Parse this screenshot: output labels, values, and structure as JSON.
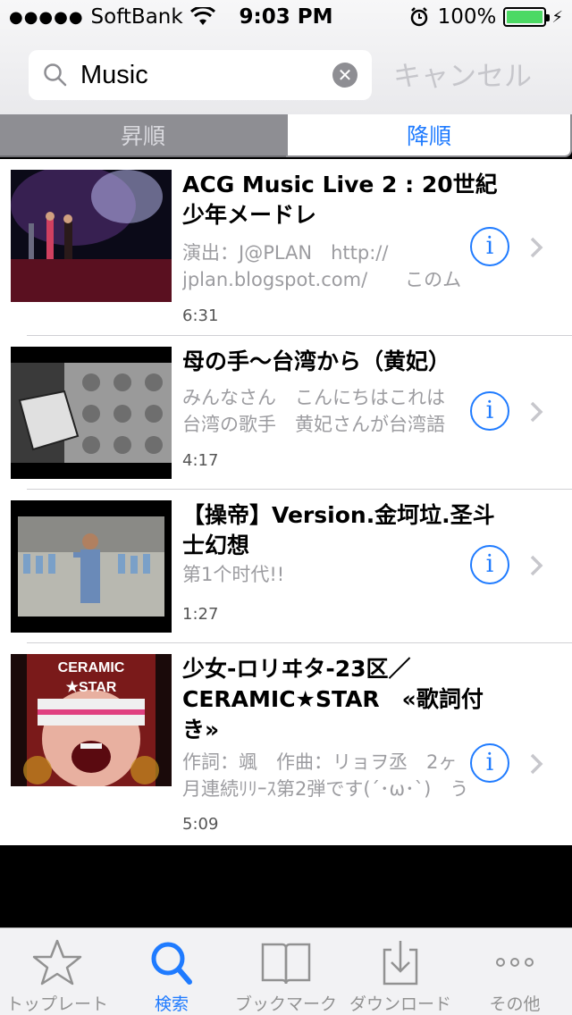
{
  "status": {
    "carrier": "SoftBank",
    "time": "9:03 PM",
    "battery": "100%"
  },
  "search": {
    "value": "Music",
    "cancel_label": "キャンセル"
  },
  "sort": {
    "ascending": "昇順",
    "descending": "降順"
  },
  "items": [
    {
      "title": "ACG Music Live 2 : 20世紀少年メードレ",
      "description": "演出：J@PLAN　http://\njplan.blogspot.com/　　このム",
      "duration": "6:31"
    },
    {
      "title": "母の手〜台湾から（黄妃）",
      "description": "みんなさん　こんにちはこれは\n台湾の歌手　黄妃さんが台湾語",
      "duration": "4:17"
    },
    {
      "title": "【操帝】Version.金坷垃.圣斗士幻想",
      "description": "第1个时代!!",
      "duration": "1:27"
    },
    {
      "title": "少女-ロリヰタ-23区／CERAMIC★STAR　«歌詞付き»",
      "description": "作詞：颯　作曲：リョヲ丞　2ヶ\n月連続ﾘﾘｰｽ第2弾です(´･ω･`)　う",
      "duration": "5:09",
      "thumb_text": "CERAMIC STAR"
    }
  ],
  "tabs": [
    {
      "label": "トップレート",
      "icon": "star-icon"
    },
    {
      "label": "検索",
      "icon": "search-icon"
    },
    {
      "label": "ブックマーク",
      "icon": "book-icon"
    },
    {
      "label": "ダウンロード",
      "icon": "download-icon"
    },
    {
      "label": "その他",
      "icon": "more-icon"
    }
  ],
  "colors": {
    "accent": "#1f7bff",
    "segment_inactive": "#8e8e93",
    "battery_green": "#4cd964"
  }
}
